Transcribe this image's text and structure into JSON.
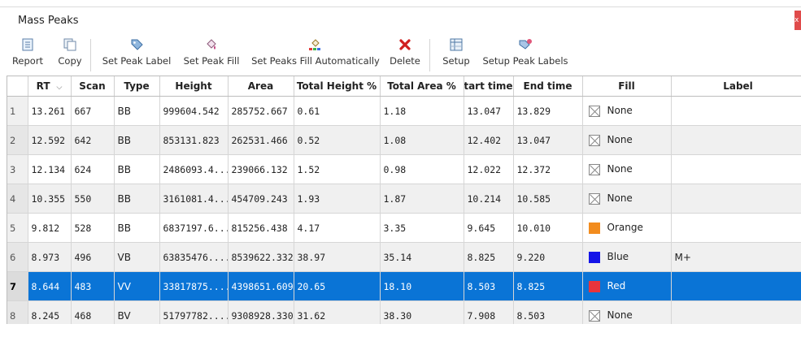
{
  "window": {
    "title": "Mass Peaks",
    "close_label": "x"
  },
  "toolbar": [
    {
      "label": "Report",
      "icon": "report-icon"
    },
    {
      "label": "Copy",
      "icon": "copy-icon"
    },
    {
      "label": "Set Peak Label",
      "icon": "tag-icon"
    },
    {
      "label": "Set Peak Fill",
      "icon": "paint-bucket-icon"
    },
    {
      "label": "Set Peaks Fill Automatically",
      "icon": "auto-fill-icon"
    },
    {
      "label": "Delete",
      "icon": "delete-icon"
    },
    {
      "label": "Setup",
      "icon": "setup-icon"
    },
    {
      "label": "Setup Peak Labels",
      "icon": "tag-setup-icon"
    }
  ],
  "columns": [
    "RT",
    "Scan",
    "Type",
    "Height",
    "Area",
    "Total Height %",
    "Total Area %",
    "Start time",
    "End time",
    "Fill",
    "Label"
  ],
  "rows": [
    {
      "n": "1",
      "rt": "13.261",
      "scan": "667",
      "type": "BB",
      "height": "999604.542",
      "area": "285752.667",
      "th": "0.61",
      "ta": "1.18",
      "start": "13.047",
      "end": "13.829",
      "fill": "None",
      "fill_color": "none",
      "label": ""
    },
    {
      "n": "2",
      "rt": "12.592",
      "scan": "642",
      "type": "BB",
      "height": "853131.823",
      "area": "262531.466",
      "th": "0.52",
      "ta": "1.08",
      "start": "12.402",
      "end": "13.047",
      "fill": "None",
      "fill_color": "none",
      "label": ""
    },
    {
      "n": "3",
      "rt": "12.134",
      "scan": "624",
      "type": "BB",
      "height": "2486093.4...",
      "area": "239066.132",
      "th": "1.52",
      "ta": "0.98",
      "start": "12.022",
      "end": "12.372",
      "fill": "None",
      "fill_color": "none",
      "label": ""
    },
    {
      "n": "4",
      "rt": "10.355",
      "scan": "550",
      "type": "BB",
      "height": "3161081.4...",
      "area": "454709.243",
      "th": "1.93",
      "ta": "1.87",
      "start": "10.214",
      "end": "10.585",
      "fill": "None",
      "fill_color": "none",
      "label": ""
    },
    {
      "n": "5",
      "rt": "9.812",
      "scan": "528",
      "type": "BB",
      "height": "6837197.6...",
      "area": "815256.438",
      "th": "4.17",
      "ta": "3.35",
      "start": "9.645",
      "end": "10.010",
      "fill": "Orange",
      "fill_color": "#f28c1e",
      "label": ""
    },
    {
      "n": "6",
      "rt": "8.973",
      "scan": "496",
      "type": "VB",
      "height": "63835476....",
      "area": "8539622.332",
      "th": "38.97",
      "ta": "35.14",
      "start": "8.825",
      "end": "9.220",
      "fill": "Blue",
      "fill_color": "#1414e8",
      "label": "M+"
    },
    {
      "n": "7",
      "rt": "8.644",
      "scan": "483",
      "type": "VV",
      "height": "33817875....",
      "area": "4398651.609",
      "th": "20.65",
      "ta": "18.10",
      "start": "8.503",
      "end": "8.825",
      "fill": "Red",
      "fill_color": "#e8343c",
      "label": ""
    },
    {
      "n": "8",
      "rt": "8.245",
      "scan": "468",
      "type": "BV",
      "height": "51797782....",
      "area": "9308928.330",
      "th": "31.62",
      "ta": "38.30",
      "start": "7.908",
      "end": "8.503",
      "fill": "None",
      "fill_color": "none",
      "label": ""
    }
  ],
  "selected_row": 7
}
